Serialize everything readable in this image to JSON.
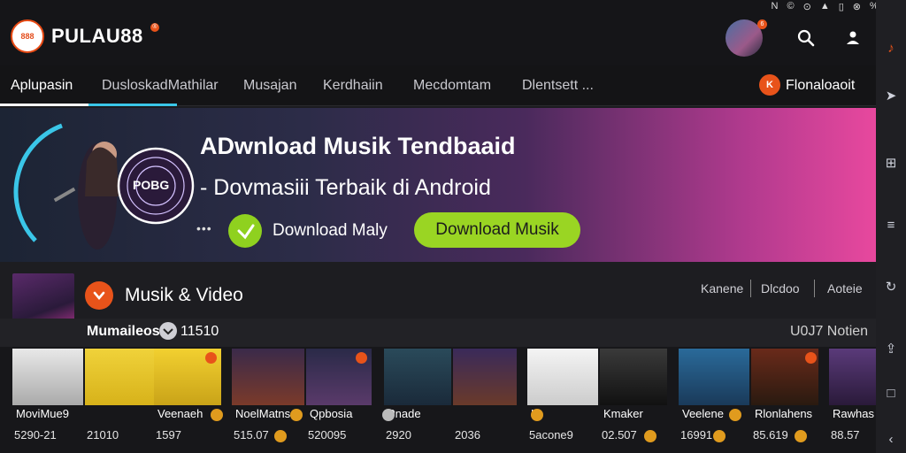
{
  "app": {
    "logo_badge": "888",
    "logo_text": "PULAU88",
    "logo_sup": "®",
    "avatar_badge": "6"
  },
  "status_bar": [
    "N",
    "©",
    "⊙",
    "▲",
    "▯",
    "⊗",
    "%",
    "⊡"
  ],
  "header_icons": [
    "search-icon",
    "user-icon"
  ],
  "nav": {
    "tabs": [
      {
        "label": "Aplupasin",
        "active": true
      },
      {
        "label": "DusloskadMathilar",
        "active": false
      },
      {
        "label": "Musajan",
        "active": false
      },
      {
        "label": "Kerdhaiin",
        "active": false
      },
      {
        "label": "Mecdomtam",
        "active": false
      },
      {
        "label": "Dlentsett ...",
        "active": false
      }
    ],
    "right_badge": "K",
    "right_label": "Flonaloaoit"
  },
  "banner": {
    "title": "ADwnload Musik Tendbaaid",
    "subtitle": "- Dovmasiii Terbaik di Android",
    "dots": "•••",
    "download_label": "Download Maly",
    "download_button": "Download Musik"
  },
  "section": {
    "title": "Musik & Video",
    "filters": [
      "Kanene",
      "Dlcdoo",
      "Aoteie"
    ],
    "sub_label": "Mumaileos",
    "sub_count": "11510",
    "sub_right": "U0J7 Notien"
  },
  "tiles": [
    {
      "title": "MoviMue9",
      "meta": "5290-21"
    },
    {
      "title": "",
      "meta": "21010"
    },
    {
      "title": "Veenaeh",
      "meta": "1597"
    },
    {
      "title": "NoelMatns",
      "meta": "515.07"
    },
    {
      "title": "Qpbosia",
      "meta": "520095"
    },
    {
      "title": "Pnade",
      "meta": "2920"
    },
    {
      "title": "",
      "meta": "2036"
    },
    {
      "title": "K",
      "meta": "5acone9"
    },
    {
      "title": "Kmaker",
      "meta": "02.507"
    },
    {
      "title": "Veelene",
      "meta": "16991"
    },
    {
      "title": "Rlonlahens",
      "meta": "85.619"
    },
    {
      "title": "Rawhas",
      "meta": "88.57"
    }
  ],
  "rail_icons": [
    "guitar-icon",
    "arrow-icon",
    "grid-icon",
    "menu-icon",
    "refresh-icon",
    "share-icon",
    "square-icon",
    "back-icon"
  ],
  "colors": {
    "accent_orange": "#e8531a",
    "accent_green": "#9ad523",
    "banner_pink": "#e8489e",
    "tab_underline_cyan": "#3ac6e8"
  }
}
